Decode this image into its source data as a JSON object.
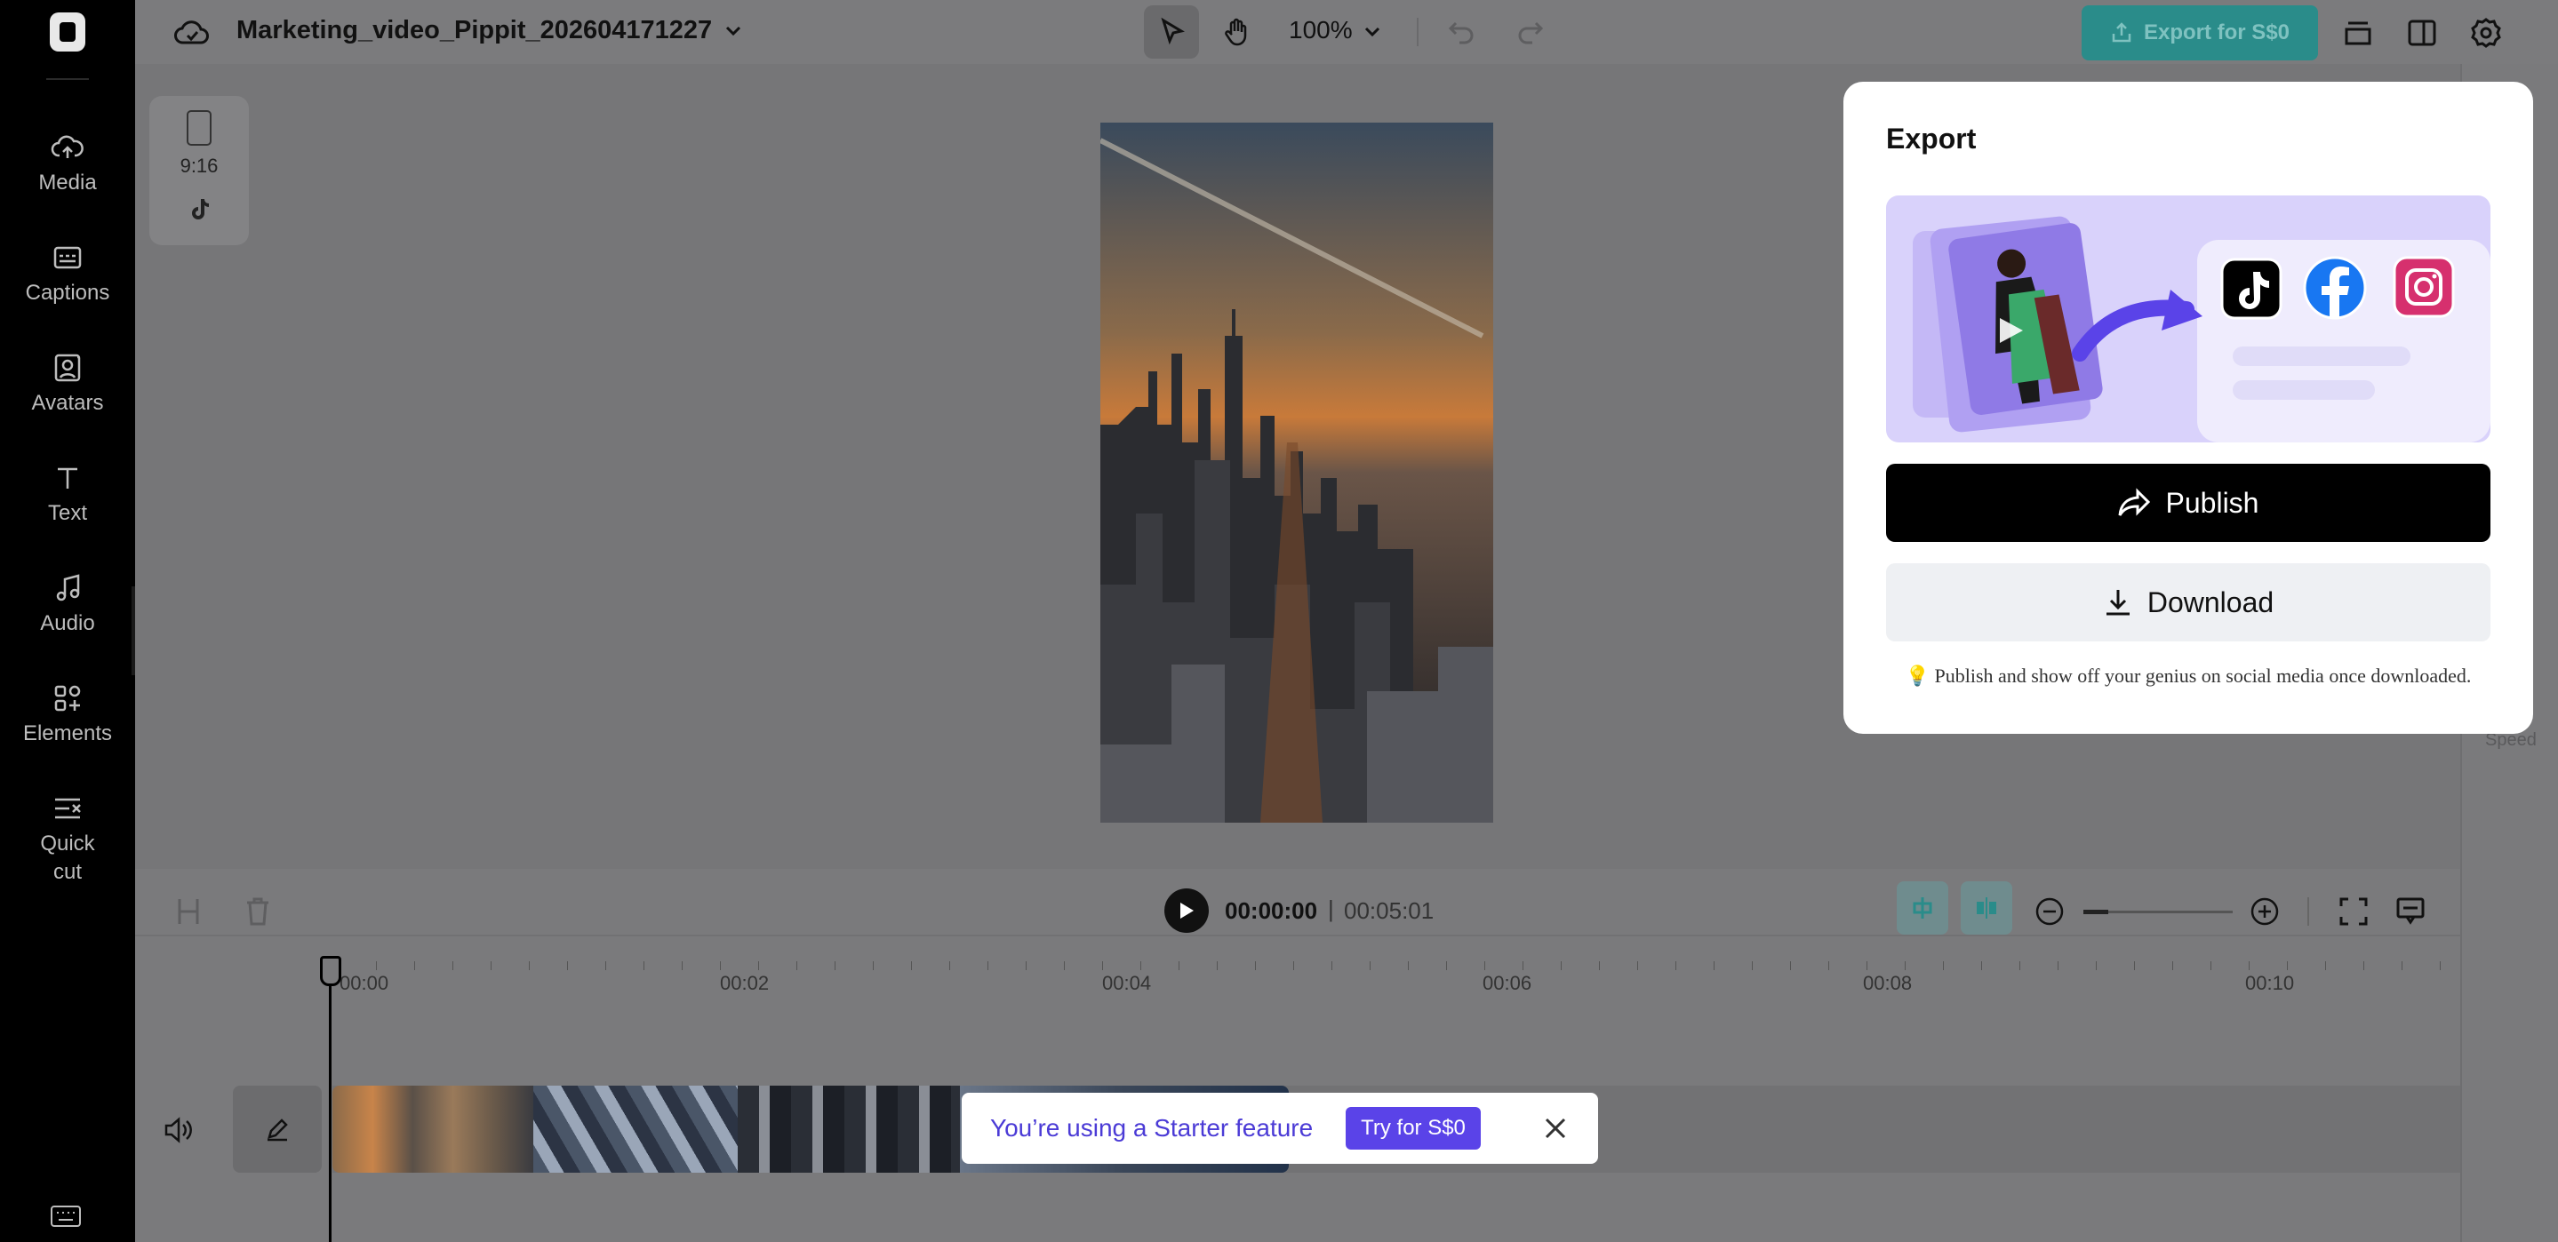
{
  "sidebar": {
    "items": [
      {
        "label": "Media",
        "icon": "cloud-upload-icon"
      },
      {
        "label": "Captions",
        "icon": "captions-icon"
      },
      {
        "label": "Avatars",
        "icon": "avatar-icon"
      },
      {
        "label": "Text",
        "icon": "text-icon"
      },
      {
        "label": "Audio",
        "icon": "music-icon"
      },
      {
        "label": "Elements",
        "icon": "elements-icon"
      },
      {
        "label": "Quick\ncut",
        "icon": "quick-cut-icon"
      }
    ]
  },
  "header": {
    "project_title": "Marketing_video_Pippit_202604171227",
    "zoom": "100%",
    "export_label": "Export for S$0"
  },
  "canvas": {
    "ratio": "9:16"
  },
  "right_panel": {
    "speed_label": "Speed"
  },
  "playback": {
    "current_time": "00:00:00",
    "separator": "|",
    "total_time": "00:05:01"
  },
  "timeline": {
    "ruler": [
      "00:00",
      "00:02",
      "00:04",
      "00:06",
      "00:08",
      "00:10"
    ]
  },
  "toast": {
    "message": "You’re using a Starter feature",
    "button": "Try for S$0"
  },
  "export_popup": {
    "title": "Export",
    "publish_label": "Publish",
    "download_label": "Download",
    "note": "💡 Publish and show off your genius on social media once downloaded."
  },
  "colors": {
    "accent": "#5a43e8",
    "export_button": "#2a8c8a",
    "sidebar_bg": "#000000"
  }
}
